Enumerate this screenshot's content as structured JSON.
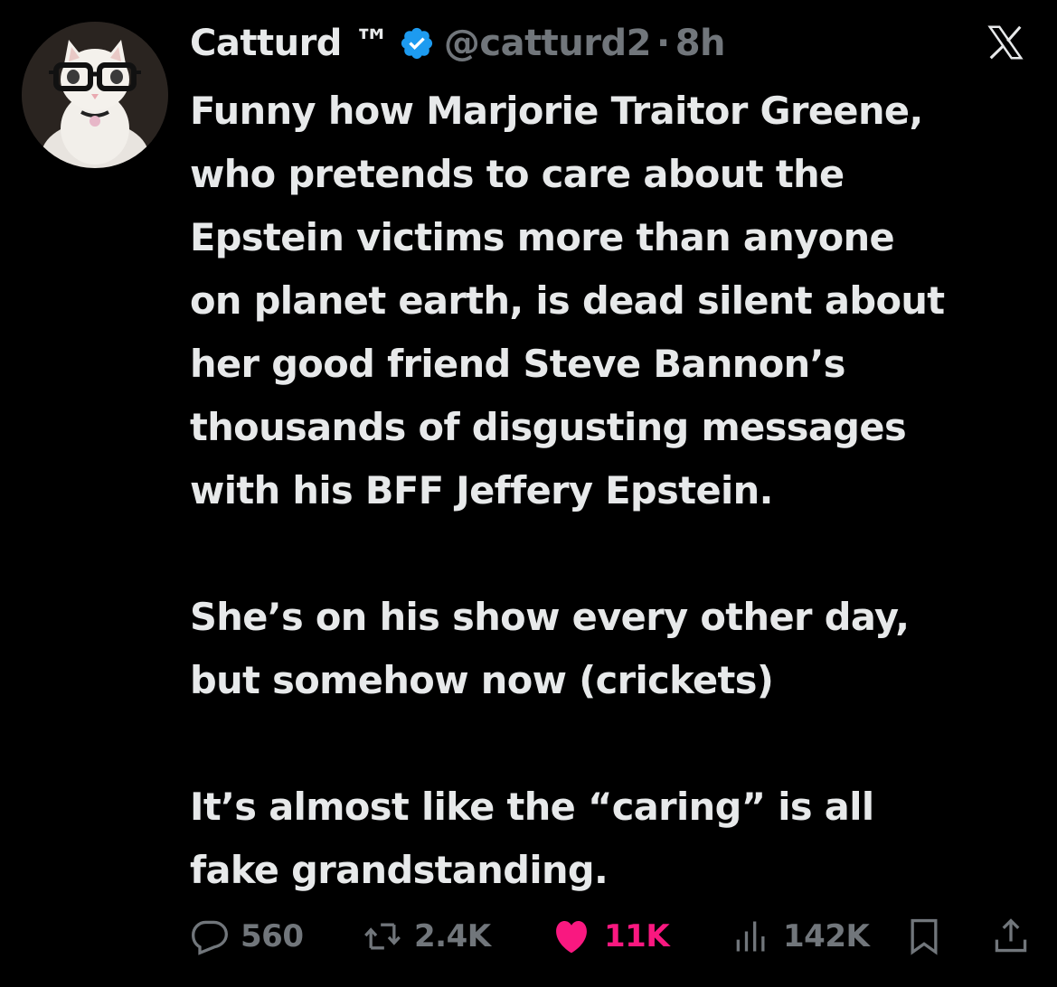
{
  "author": {
    "display_name": "Catturd ™",
    "handle": "@catturd2",
    "separator": "·",
    "time": "8h",
    "verified": true,
    "avatar_icon": "cat-with-glasses-avatar"
  },
  "platform_logo": "x-logo-icon",
  "tweet": {
    "paragraphs": [
      "Funny how Marjorie Traitor Greene,\nwho pretends to care about the\nEpstein victims more than anyone\non planet earth, is dead silent about\nher good friend Steve Bannon’s\nthousands of disgusting messages\nwith his BFF Jeffery Epstein.",
      "She’s on his show every other day,\nbut somehow now (crickets)",
      "It’s almost like the “caring” is all\nfake grandstanding."
    ]
  },
  "actions": {
    "replies": "560",
    "reposts": "2.4K",
    "likes": "11K",
    "views": "142K"
  },
  "colors": {
    "background": "#000000",
    "text": "#e7e9ea",
    "muted": "#71767b",
    "verified_blue": "#1d9bf0",
    "like_pink": "#f91880"
  }
}
